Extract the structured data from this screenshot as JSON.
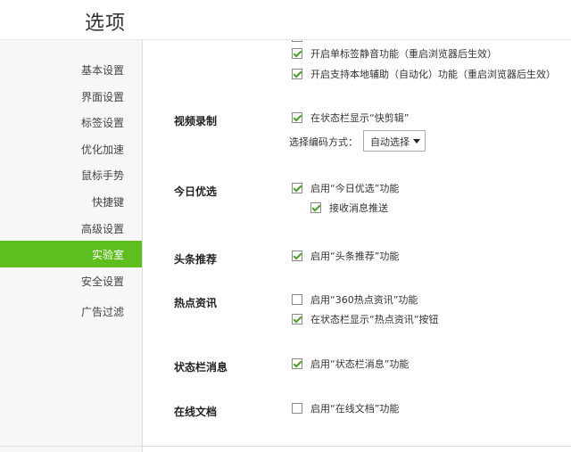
{
  "window": {
    "title": "选项"
  },
  "sidebar": {
    "items": [
      {
        "label": "基本设置",
        "active": false
      },
      {
        "label": "界面设置",
        "active": false
      },
      {
        "label": "标签设置",
        "active": false
      },
      {
        "label": "优化加速",
        "active": false
      },
      {
        "label": "鼠标手势",
        "active": false
      },
      {
        "label": "快捷键",
        "active": false
      },
      {
        "label": "高级设置",
        "active": false
      },
      {
        "label": "实验室",
        "active": true
      },
      {
        "label": "安全设置",
        "active": false
      },
      {
        "label": "广告过滤",
        "active": false
      }
    ]
  },
  "content": {
    "top_options": [
      {
        "label": "开启单标签静音功能（重启浏览器后生效）",
        "checked": true
      },
      {
        "label": "开启支持本地辅助（自动化）功能（重启浏览器后生效）",
        "checked": true
      }
    ],
    "sections": {
      "video": {
        "label": "视频录制",
        "options": [
          {
            "label": "在状态栏显示“快剪辑”",
            "checked": true
          }
        ],
        "encode_label": "选择编码方式：",
        "encode_value": "自动选择"
      },
      "today": {
        "label": "今日优选",
        "options": [
          {
            "label": "启用“今日优选”功能",
            "checked": true
          },
          {
            "label": "接收消息推送",
            "checked": true
          }
        ]
      },
      "headline": {
        "label": "头条推荐",
        "options": [
          {
            "label": "启用“头条推荐”功能",
            "checked": true
          }
        ]
      },
      "hot": {
        "label": "热点资讯",
        "options": [
          {
            "label": "启用“360热点资讯”功能",
            "checked": false
          },
          {
            "label": "在状态栏显示“热点资讯”按钮",
            "checked": true
          }
        ]
      },
      "statusbar": {
        "label": "状态栏消息",
        "options": [
          {
            "label": "启用“状态栏消息”功能",
            "checked": true
          }
        ]
      },
      "docs": {
        "label": "在线文档",
        "options": [
          {
            "label": "启用“在线文档”功能",
            "checked": false
          }
        ]
      }
    }
  }
}
